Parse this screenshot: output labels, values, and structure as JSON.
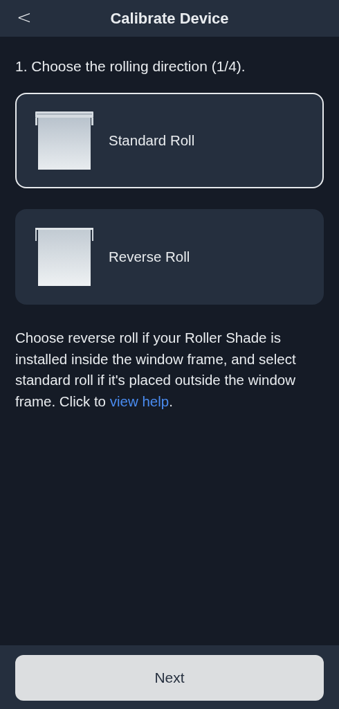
{
  "header": {
    "back_icon": "<",
    "title": "Calibrate Device"
  },
  "step": "1. Choose the rolling direction (1/4).",
  "options": [
    {
      "kind": "standard",
      "label": "Standard Roll",
      "selected": true
    },
    {
      "kind": "reverse",
      "label": "Reverse Roll",
      "selected": false
    }
  ],
  "help": {
    "text": "Choose reverse roll if your Roller Shade is installed inside the window frame, and select standard roll if it's placed outside the window frame. Click to ",
    "link": "view help",
    "after": "."
  },
  "footer": {
    "button": "Next"
  }
}
